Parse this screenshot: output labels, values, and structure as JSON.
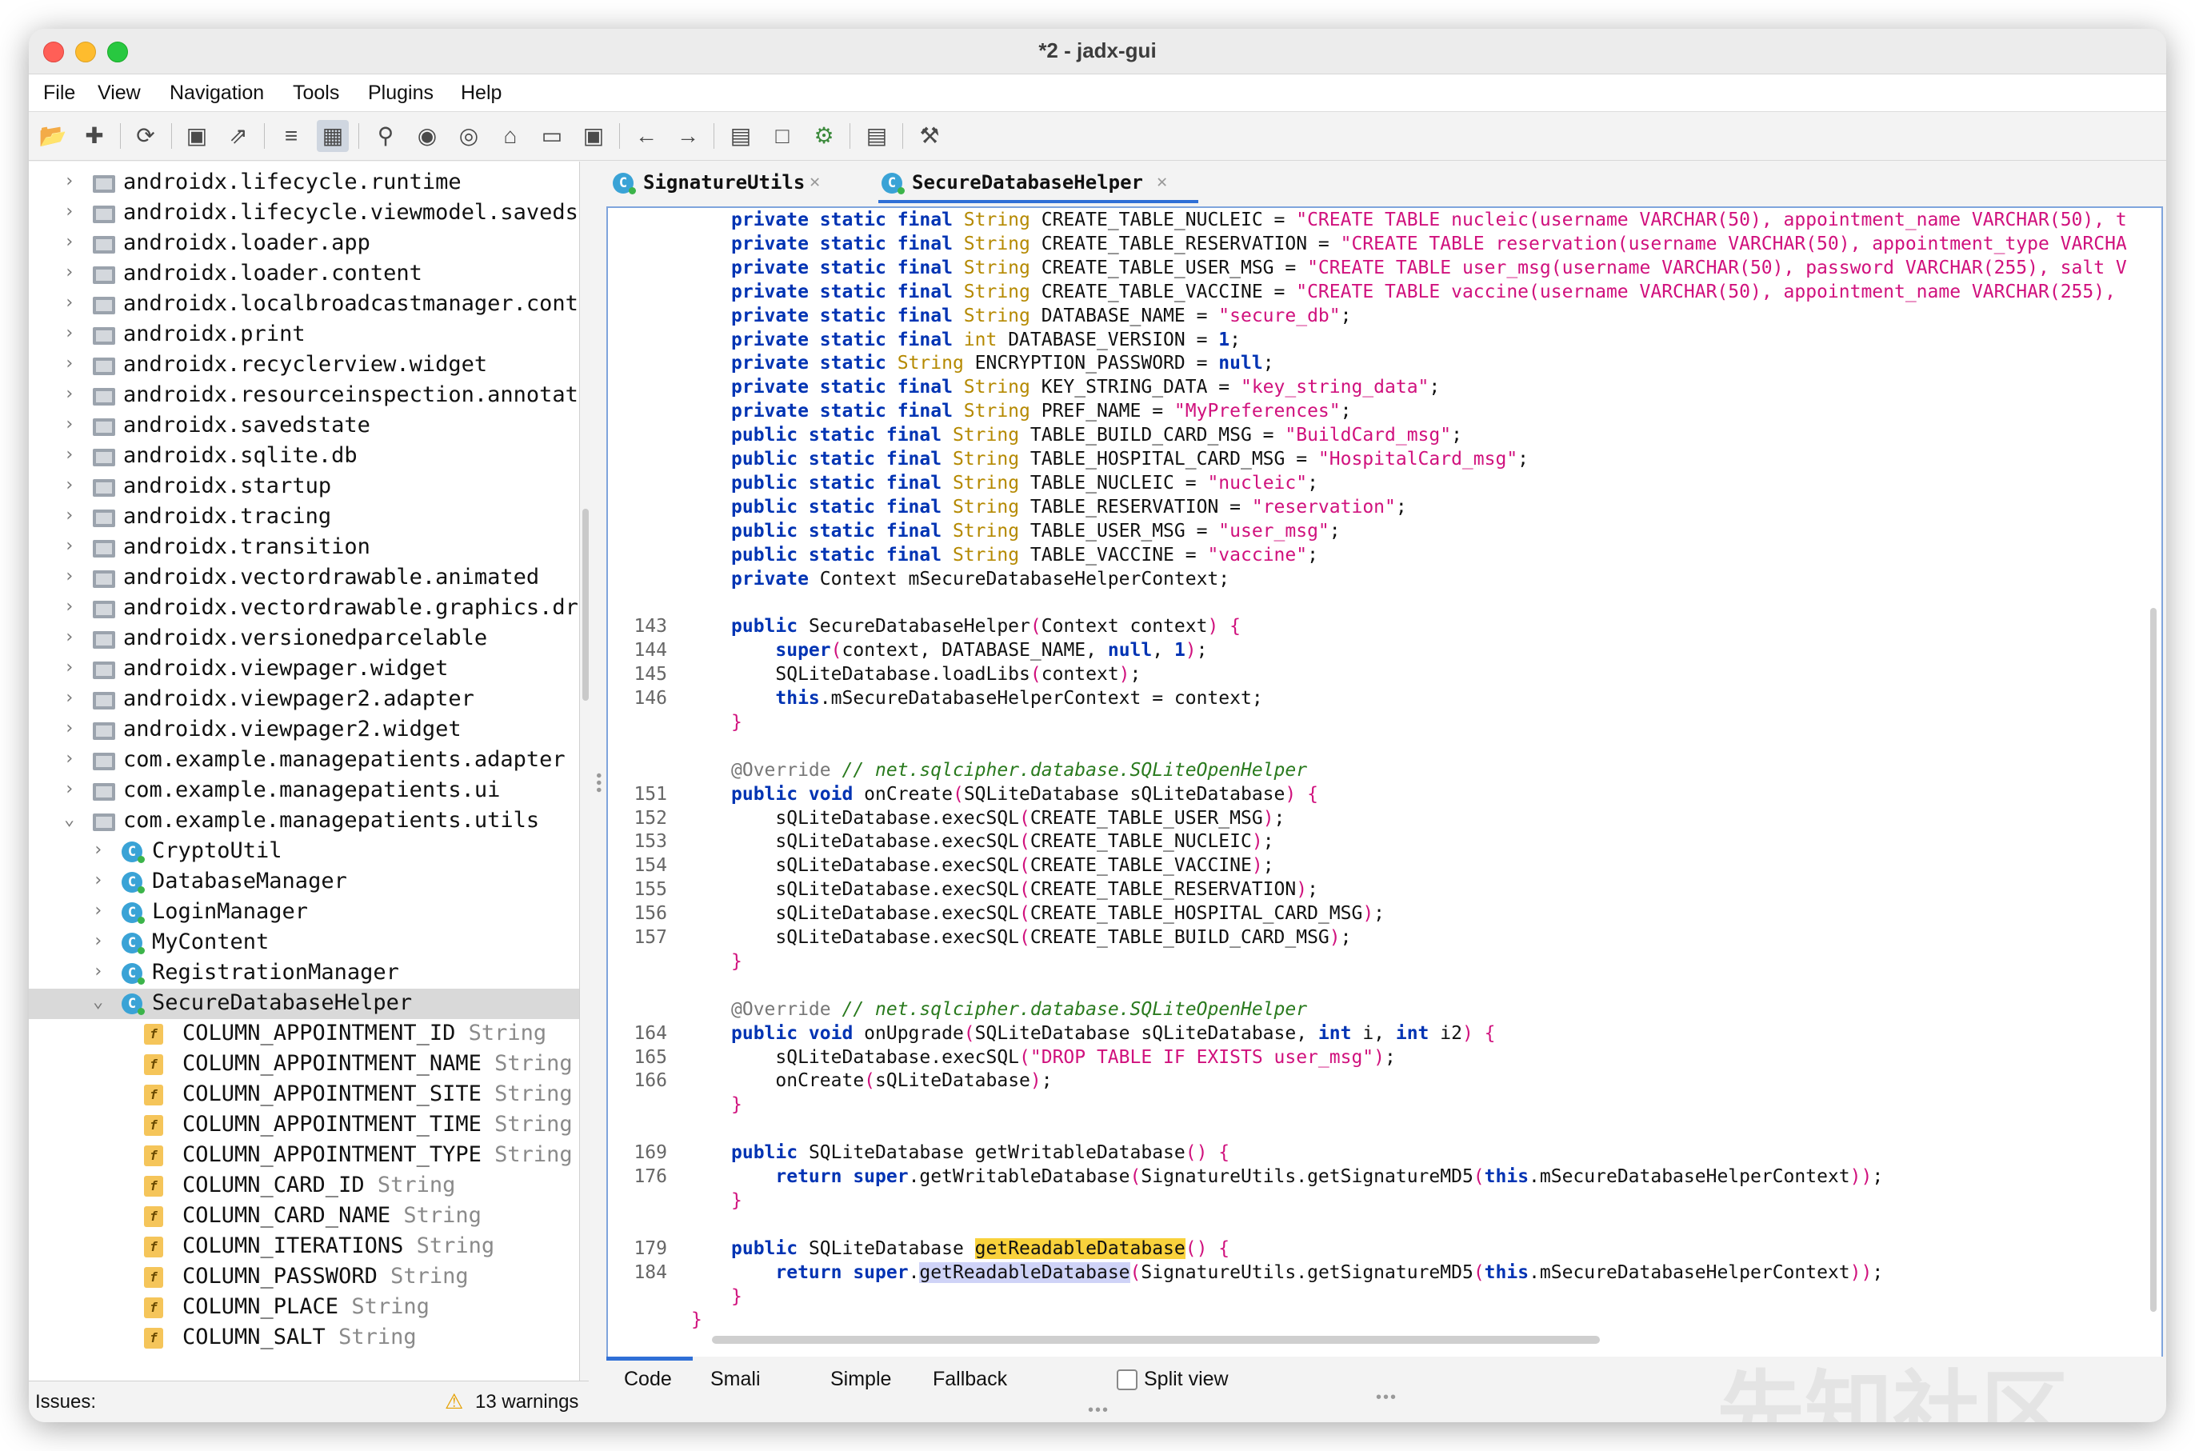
{
  "window": {
    "title": "*2 - jadx-gui"
  },
  "menu": [
    "File",
    "View",
    "Navigation",
    "Tools",
    "Plugins",
    "Help"
  ],
  "toolbar_icons": [
    "open-file-icon",
    "add-files-icon",
    "sync-icon",
    "save-icon",
    "export-icon",
    "flatten-icon",
    "package-view-icon",
    "search-icon",
    "find-usage-icon",
    "search-class-icon",
    "home-icon",
    "window-icon",
    "decompile-icon",
    "back-icon",
    "forward-icon",
    "log-icon",
    "bookmark-icon",
    "debug-icon",
    "list-icon",
    "settings-icon"
  ],
  "tree": {
    "items": [
      {
        "kind": "pkg",
        "label": "androidx.lifecycle.runtime"
      },
      {
        "kind": "pkg",
        "label": "androidx.lifecycle.viewmodel.savedst"
      },
      {
        "kind": "pkg",
        "label": "androidx.loader.app"
      },
      {
        "kind": "pkg",
        "label": "androidx.loader.content"
      },
      {
        "kind": "pkg",
        "label": "androidx.localbroadcastmanager.conte"
      },
      {
        "kind": "pkg",
        "label": "androidx.print"
      },
      {
        "kind": "pkg",
        "label": "androidx.recyclerview.widget"
      },
      {
        "kind": "pkg",
        "label": "androidx.resourceinspection.annotat:"
      },
      {
        "kind": "pkg",
        "label": "androidx.savedstate"
      },
      {
        "kind": "pkg",
        "label": "androidx.sqlite.db"
      },
      {
        "kind": "pkg",
        "label": "androidx.startup"
      },
      {
        "kind": "pkg",
        "label": "androidx.tracing"
      },
      {
        "kind": "pkg",
        "label": "androidx.transition"
      },
      {
        "kind": "pkg",
        "label": "androidx.vectordrawable.animated"
      },
      {
        "kind": "pkg",
        "label": "androidx.vectordrawable.graphics.dra"
      },
      {
        "kind": "pkg",
        "label": "androidx.versionedparcelable"
      },
      {
        "kind": "pkg",
        "label": "androidx.viewpager.widget"
      },
      {
        "kind": "pkg",
        "label": "androidx.viewpager2.adapter"
      },
      {
        "kind": "pkg",
        "label": "androidx.viewpager2.widget"
      },
      {
        "kind": "pkg",
        "label": "com.example.managepatients.adapter"
      },
      {
        "kind": "pkg",
        "label": "com.example.managepatients.ui"
      },
      {
        "kind": "pkg-open",
        "label": "com.example.managepatients.utils"
      },
      {
        "kind": "cls",
        "label": "CryptoUtil"
      },
      {
        "kind": "cls",
        "label": "DatabaseManager"
      },
      {
        "kind": "cls",
        "label": "LoginManager"
      },
      {
        "kind": "cls",
        "label": "MyContent"
      },
      {
        "kind": "cls",
        "label": "RegistrationManager"
      },
      {
        "kind": "cls-open",
        "label": "SecureDatabaseHelper",
        "selected": true
      },
      {
        "kind": "fld",
        "label": "COLUMN_APPOINTMENT_ID",
        "type": "String"
      },
      {
        "kind": "fld",
        "label": "COLUMN_APPOINTMENT_NAME",
        "type": "String"
      },
      {
        "kind": "fld",
        "label": "COLUMN_APPOINTMENT_SITE",
        "type": "String"
      },
      {
        "kind": "fld",
        "label": "COLUMN_APPOINTMENT_TIME",
        "type": "String"
      },
      {
        "kind": "fld",
        "label": "COLUMN_APPOINTMENT_TYPE",
        "type": "String"
      },
      {
        "kind": "fld",
        "label": "COLUMN_CARD_ID",
        "type": "String"
      },
      {
        "kind": "fld",
        "label": "COLUMN_CARD_NAME",
        "type": "String"
      },
      {
        "kind": "fld",
        "label": "COLUMN_ITERATIONS",
        "type": "String"
      },
      {
        "kind": "fld",
        "label": "COLUMN_PASSWORD",
        "type": "String"
      },
      {
        "kind": "fld",
        "label": "COLUMN_PLACE",
        "type": "String"
      },
      {
        "kind": "fld",
        "label": "COLUMN_SALT",
        "type": "String"
      }
    ]
  },
  "status": {
    "issues_label": "Issues:",
    "warnings": "13 warnings"
  },
  "tabs": [
    {
      "label": "SignatureUtils",
      "active": false
    },
    {
      "label": "SecureDatabaseHelper",
      "active": true
    }
  ],
  "code": [
    {
      "n": "",
      "t": [
        [
          "kw",
          "private static final "
        ],
        [
          "ty",
          "String "
        ],
        [
          "",
          "CREATE_TABLE_NUCLEIC = "
        ],
        [
          "st",
          "\"CREATE TABLE nucleic(username VARCHAR(50), appointment_name VARCHAR(50), t"
        ]
      ]
    },
    {
      "n": "",
      "t": [
        [
          "kw",
          "private static final "
        ],
        [
          "ty",
          "String "
        ],
        [
          "",
          "CREATE_TABLE_RESERVATION = "
        ],
        [
          "st",
          "\"CREATE TABLE reservation(username VARCHAR(50), appointment_type VARCHA"
        ]
      ]
    },
    {
      "n": "",
      "t": [
        [
          "kw",
          "private static final "
        ],
        [
          "ty",
          "String "
        ],
        [
          "",
          "CREATE_TABLE_USER_MSG = "
        ],
        [
          "st",
          "\"CREATE TABLE user_msg(username VARCHAR(50), password VARCHAR(255), salt V"
        ]
      ]
    },
    {
      "n": "",
      "t": [
        [
          "kw",
          "private static final "
        ],
        [
          "ty",
          "String "
        ],
        [
          "",
          "CREATE_TABLE_VACCINE = "
        ],
        [
          "st",
          "\"CREATE TABLE vaccine(username VARCHAR(50), appointment_name VARCHAR(255), "
        ]
      ]
    },
    {
      "n": "",
      "t": [
        [
          "kw",
          "private static final "
        ],
        [
          "ty",
          "String "
        ],
        [
          "",
          "DATABASE_NAME = "
        ],
        [
          "st",
          "\"secure_db\""
        ],
        [
          "",
          ";"
        ]
      ]
    },
    {
      "n": "",
      "t": [
        [
          "kw",
          "private static final "
        ],
        [
          "ty",
          "int "
        ],
        [
          "",
          "DATABASE_VERSION = "
        ],
        [
          "kw",
          "1"
        ],
        [
          "",
          ";"
        ]
      ]
    },
    {
      "n": "",
      "t": [
        [
          "kw",
          "private static "
        ],
        [
          "ty",
          "String "
        ],
        [
          "",
          "ENCRYPTION_PASSWORD = "
        ],
        [
          "kw",
          "null"
        ],
        [
          "",
          ";"
        ]
      ]
    },
    {
      "n": "",
      "t": [
        [
          "kw",
          "private static final "
        ],
        [
          "ty",
          "String "
        ],
        [
          "",
          "KEY_STRING_DATA = "
        ],
        [
          "st",
          "\"key_string_data\""
        ],
        [
          "",
          ";"
        ]
      ]
    },
    {
      "n": "",
      "t": [
        [
          "kw",
          "private static final "
        ],
        [
          "ty",
          "String "
        ],
        [
          "",
          "PREF_NAME = "
        ],
        [
          "st",
          "\"MyPreferences\""
        ],
        [
          "",
          ";"
        ]
      ]
    },
    {
      "n": "",
      "t": [
        [
          "kw",
          "public static final "
        ],
        [
          "ty",
          "String "
        ],
        [
          "",
          "TABLE_BUILD_CARD_MSG = "
        ],
        [
          "st",
          "\"BuildCard_msg\""
        ],
        [
          "",
          ";"
        ]
      ]
    },
    {
      "n": "",
      "t": [
        [
          "kw",
          "public static final "
        ],
        [
          "ty",
          "String "
        ],
        [
          "",
          "TABLE_HOSPITAL_CARD_MSG = "
        ],
        [
          "st",
          "\"HospitalCard_msg\""
        ],
        [
          "",
          ";"
        ]
      ]
    },
    {
      "n": "",
      "t": [
        [
          "kw",
          "public static final "
        ],
        [
          "ty",
          "String "
        ],
        [
          "",
          "TABLE_NUCLEIC = "
        ],
        [
          "st",
          "\"nucleic\""
        ],
        [
          "",
          ";"
        ]
      ]
    },
    {
      "n": "",
      "t": [
        [
          "kw",
          "public static final "
        ],
        [
          "ty",
          "String "
        ],
        [
          "",
          "TABLE_RESERVATION = "
        ],
        [
          "st",
          "\"reservation\""
        ],
        [
          "",
          ";"
        ]
      ]
    },
    {
      "n": "",
      "t": [
        [
          "kw",
          "public static final "
        ],
        [
          "ty",
          "String "
        ],
        [
          "",
          "TABLE_USER_MSG = "
        ],
        [
          "st",
          "\"user_msg\""
        ],
        [
          "",
          ";"
        ]
      ]
    },
    {
      "n": "",
      "t": [
        [
          "kw",
          "public static final "
        ],
        [
          "ty",
          "String "
        ],
        [
          "",
          "TABLE_VACCINE = "
        ],
        [
          "st",
          "\"vaccine\""
        ],
        [
          "",
          ";"
        ]
      ]
    },
    {
      "n": "",
      "t": [
        [
          "kw",
          "private "
        ],
        [
          "",
          "Context mSecureDatabaseHelperContext;"
        ]
      ]
    },
    {
      "n": "",
      "t": []
    },
    {
      "n": "143",
      "t": [
        [
          "kw",
          "public "
        ],
        [
          "",
          "SecureDatabaseHelper"
        ],
        [
          "st",
          "("
        ],
        [
          "",
          "Context context"
        ],
        [
          "st",
          ") {"
        ]
      ]
    },
    {
      "n": "144",
      "t": [
        [
          "",
          "    "
        ],
        [
          "kw",
          "super"
        ],
        [
          "st",
          "("
        ],
        [
          "",
          "context, DATABASE_NAME, "
        ],
        [
          "kw",
          "null"
        ],
        [
          "",
          ", "
        ],
        [
          "kw",
          "1"
        ],
        [
          "st",
          ")"
        ],
        [
          "",
          ";"
        ]
      ]
    },
    {
      "n": "145",
      "t": [
        [
          "",
          "    SQLiteDatabase.loadLibs"
        ],
        [
          "st",
          "("
        ],
        [
          "",
          "context"
        ],
        [
          "st",
          ")"
        ],
        [
          "",
          ";"
        ]
      ]
    },
    {
      "n": "146",
      "t": [
        [
          "",
          "    "
        ],
        [
          "kw",
          "this"
        ],
        [
          "",
          ".mSecureDatabaseHelperContext = context;"
        ]
      ]
    },
    {
      "n": "",
      "t": [
        [
          "st",
          "}"
        ]
      ]
    },
    {
      "n": "",
      "t": []
    },
    {
      "n": "",
      "t": [
        [
          "an",
          "@Override "
        ],
        [
          "cm",
          "// net.sqlcipher.database.SQLiteOpenHelper"
        ]
      ]
    },
    {
      "n": "151",
      "t": [
        [
          "kw",
          "public void "
        ],
        [
          "",
          "onCreate"
        ],
        [
          "st",
          "("
        ],
        [
          "",
          "SQLiteDatabase sQLiteDatabase"
        ],
        [
          "st",
          ") {"
        ]
      ]
    },
    {
      "n": "152",
      "t": [
        [
          "",
          "    sQLiteDatabase.execSQL"
        ],
        [
          "st",
          "("
        ],
        [
          "",
          "CREATE_TABLE_USER_MSG"
        ],
        [
          "st",
          ")"
        ],
        [
          "",
          ";"
        ]
      ]
    },
    {
      "n": "153",
      "t": [
        [
          "",
          "    sQLiteDatabase.execSQL"
        ],
        [
          "st",
          "("
        ],
        [
          "",
          "CREATE_TABLE_NUCLEIC"
        ],
        [
          "st",
          ")"
        ],
        [
          "",
          ";"
        ]
      ]
    },
    {
      "n": "154",
      "t": [
        [
          "",
          "    sQLiteDatabase.execSQL"
        ],
        [
          "st",
          "("
        ],
        [
          "",
          "CREATE_TABLE_VACCINE"
        ],
        [
          "st",
          ")"
        ],
        [
          "",
          ";"
        ]
      ]
    },
    {
      "n": "155",
      "t": [
        [
          "",
          "    sQLiteDatabase.execSQL"
        ],
        [
          "st",
          "("
        ],
        [
          "",
          "CREATE_TABLE_RESERVATION"
        ],
        [
          "st",
          ")"
        ],
        [
          "",
          ";"
        ]
      ]
    },
    {
      "n": "156",
      "t": [
        [
          "",
          "    sQLiteDatabase.execSQL"
        ],
        [
          "st",
          "("
        ],
        [
          "",
          "CREATE_TABLE_HOSPITAL_CARD_MSG"
        ],
        [
          "st",
          ")"
        ],
        [
          "",
          ";"
        ]
      ]
    },
    {
      "n": "157",
      "t": [
        [
          "",
          "    sQLiteDatabase.execSQL"
        ],
        [
          "st",
          "("
        ],
        [
          "",
          "CREATE_TABLE_BUILD_CARD_MSG"
        ],
        [
          "st",
          ")"
        ],
        [
          "",
          ";"
        ]
      ]
    },
    {
      "n": "",
      "t": [
        [
          "st",
          "}"
        ]
      ]
    },
    {
      "n": "",
      "t": []
    },
    {
      "n": "",
      "t": [
        [
          "an",
          "@Override "
        ],
        [
          "cm",
          "// net.sqlcipher.database.SQLiteOpenHelper"
        ]
      ]
    },
    {
      "n": "164",
      "t": [
        [
          "kw",
          "public void "
        ],
        [
          "",
          "onUpgrade"
        ],
        [
          "st",
          "("
        ],
        [
          "",
          "SQLiteDatabase sQLiteDatabase, "
        ],
        [
          "kw",
          "int "
        ],
        [
          "",
          "i, "
        ],
        [
          "kw",
          "int "
        ],
        [
          "",
          "i2"
        ],
        [
          "st",
          ") {"
        ]
      ]
    },
    {
      "n": "165",
      "t": [
        [
          "",
          "    sQLiteDatabase.execSQL"
        ],
        [
          "st",
          "(\"DROP TABLE IF EXISTS user_msg\")"
        ],
        [
          "",
          ";"
        ]
      ]
    },
    {
      "n": "166",
      "t": [
        [
          "",
          "    onCreate"
        ],
        [
          "st",
          "("
        ],
        [
          "",
          "sQLiteDatabase"
        ],
        [
          "st",
          ")"
        ],
        [
          "",
          ";"
        ]
      ]
    },
    {
      "n": "",
      "t": [
        [
          "st",
          "}"
        ]
      ]
    },
    {
      "n": "",
      "t": []
    },
    {
      "n": "169",
      "t": [
        [
          "kw",
          "public "
        ],
        [
          "",
          "SQLiteDatabase getWritableDatabase"
        ],
        [
          "st",
          "() {"
        ]
      ]
    },
    {
      "n": "176",
      "t": [
        [
          "",
          "    "
        ],
        [
          "kw",
          "return super"
        ],
        [
          "",
          ".getWritableDatabase"
        ],
        [
          "st",
          "("
        ],
        [
          "",
          "SignatureUtils.getSignatureMD5"
        ],
        [
          "st",
          "("
        ],
        [
          "kw",
          "this"
        ],
        [
          "",
          ".mSecureDatabaseHelperContext"
        ],
        [
          "st",
          "))"
        ],
        [
          "",
          ";"
        ]
      ]
    },
    {
      "n": "",
      "t": [
        [
          "st",
          "}"
        ]
      ]
    },
    {
      "n": "",
      "t": []
    },
    {
      "n": "179",
      "t": [
        [
          "kw",
          "public "
        ],
        [
          "",
          "SQLiteDatabase "
        ],
        [
          "hl",
          "getReadableDatabase"
        ],
        [
          "st",
          "() {"
        ]
      ]
    },
    {
      "n": "184",
      "t": [
        [
          "",
          "    "
        ],
        [
          "kw",
          "return super"
        ],
        [
          "",
          "."
        ],
        [
          "hl2",
          "getReadableDatabase"
        ],
        [
          "st",
          "("
        ],
        [
          "",
          "SignatureUtils.getSignatureMD5"
        ],
        [
          "st",
          "("
        ],
        [
          "kw",
          "this"
        ],
        [
          "",
          ".mSecureDatabaseHelperContext"
        ],
        [
          "st",
          "))"
        ],
        [
          "",
          ";"
        ]
      ]
    },
    {
      "n": "",
      "t": [
        [
          "st",
          "}"
        ]
      ]
    },
    {
      "n": "",
      "t": [
        [
          "st",
          "}"
        ]
      ]
    }
  ],
  "bottom_tabs": [
    "Code",
    "Smali",
    "Simple",
    "Fallback"
  ],
  "split_view": {
    "label": "Split view",
    "checked": false
  },
  "watermark": "先知社区"
}
